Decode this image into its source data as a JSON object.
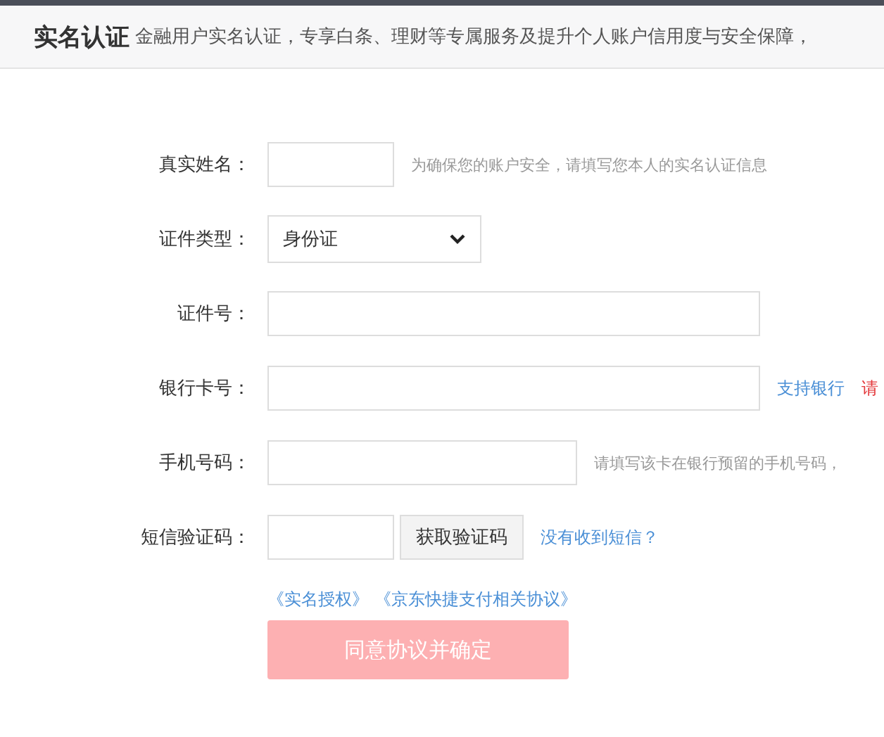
{
  "header": {
    "title": "实名认证",
    "subtitle": "金融用户实名认证，专享白条、理财等专属服务及提升个人账户信用度与安全保障，"
  },
  "rows": [
    {
      "label": "真实姓名：",
      "kind": "input",
      "notes": [
        {
          "kind": "hint",
          "text": "为确保您的账户安全，请填写您本人的实名认证信息"
        }
      ]
    },
    {
      "label": "证件类型：",
      "kind": "select",
      "value": "身份证",
      "notes": []
    },
    {
      "label": "证件号：",
      "kind": "input",
      "notes": []
    },
    {
      "label": "银行卡号：",
      "kind": "input",
      "notes": [
        {
          "kind": "link",
          "text": "支持银行"
        },
        {
          "kind": "warning",
          "text": "请"
        }
      ]
    },
    {
      "label": "手机号码：",
      "kind": "input",
      "notes": [
        {
          "kind": "hint",
          "text": "请填写该卡在银行预留的手机号码，"
        }
      ]
    },
    {
      "label": "短信验证码：",
      "kind": "code",
      "button": "获取验证码",
      "notes": [
        {
          "kind": "link",
          "text": "没有收到短信？"
        }
      ]
    }
  ],
  "agreements": [
    "《实名授权》",
    "《京东快捷支付相关协议》"
  ],
  "submit": {
    "label": "同意协议并确定",
    "disabled": true
  }
}
